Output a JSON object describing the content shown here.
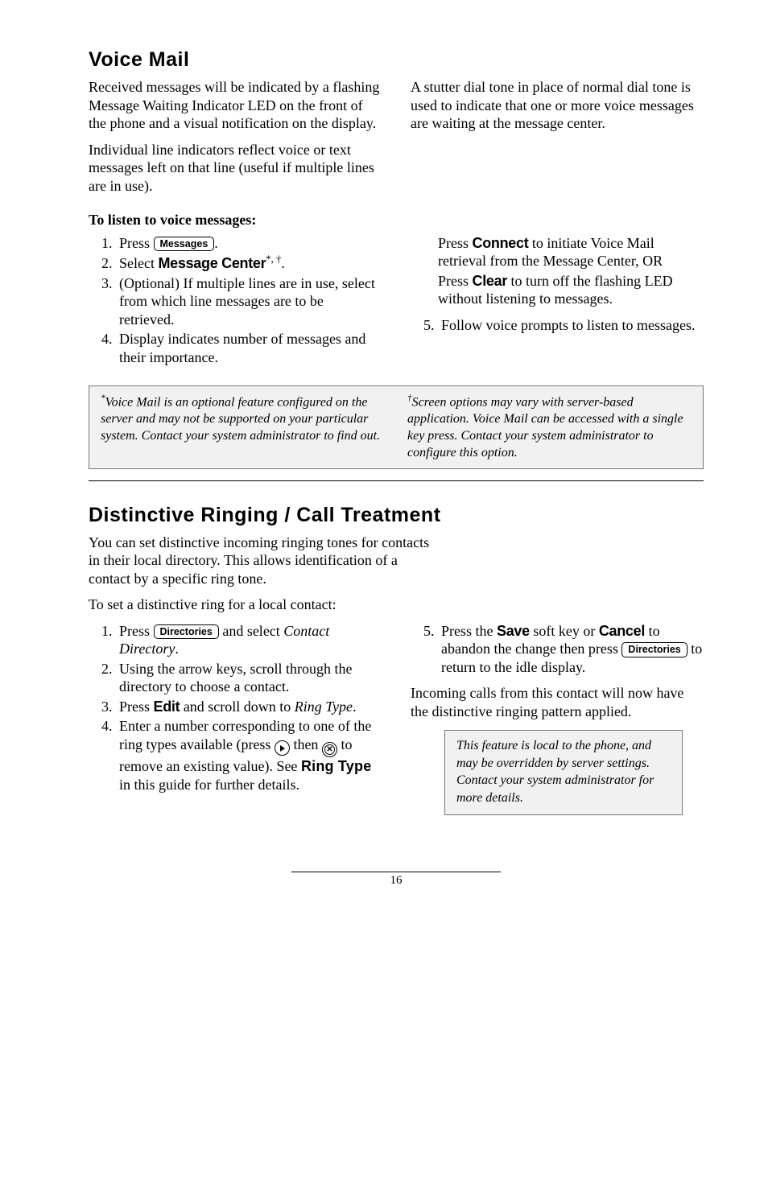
{
  "voicemail": {
    "heading": "Voice Mail",
    "left_p1": "Received messages will be indicated by a flashing Message Waiting Indicator LED on the front of the phone and a visual notification on the display.",
    "left_p2": "Individual line indicators reflect voice or text messages left on that line (useful if multiple lines are in use).",
    "right_p1": "A stutter dial tone in place of normal dial tone is used to indicate that one or more voice messages are waiting at the message center.",
    "sub1": "To listen to voice messages:",
    "step1_a": "Press ",
    "btn_messages": "Messages",
    "step1_b": ".",
    "step2_a": "Select ",
    "step2_label": "Message Center",
    "step2_sup": "*, †",
    "step2_b": ".",
    "step3": "(Optional)  If multiple lines are in use, select from which line messages are to be retrieved.",
    "step4": "Display indicates number of messages and their importance.",
    "right_indent_a": "Press ",
    "connect": "Connect",
    "right_indent_b": " to initiate Voice Mail retrieval from the Message Center, OR",
    "right_indent_c": "Press ",
    "clear": "Clear",
    "right_indent_d": " to turn off the flashing LED without listening to messages.",
    "step5": "Follow voice prompts to listen to messages.",
    "note_left": "Voice Mail is an optional feature configured on the server and may not be supported on your particular system.  Contact your system administrator to find out.",
    "note_right": "Screen options may vary with server-based application.  Voice Mail can be accessed with a single key press.  Contact your system administrator to configure this option."
  },
  "distinctive": {
    "heading": "Distinctive Ringing / Call Treatment",
    "intro": "You can set distinctive incoming ringing tones for contacts in their local directory.  This allows identification of a contact by a specific ring tone.",
    "lead": "To set a distinctive ring for a local contact:",
    "step1_a": "Press ",
    "btn_directories": "Directories",
    "step1_b": " and select ",
    "step1_c": "Contact Directory",
    "step1_d": ".",
    "step2": "Using the arrow keys, scroll through the directory to choose a contact.",
    "step3_a": "Press ",
    "edit": "Edit",
    "step3_b": " and scroll down to ",
    "step3_c": "Ring Type",
    "step3_d": ".",
    "step4_a": "Enter a number corresponding to one of the ring types available (press ",
    "step4_b": " then ",
    "step4_c": " to remove an existing value).  See ",
    "ringtype": "Ring Type",
    "step4_d": " in this guide for further details.",
    "step5_a": "Press the ",
    "save": "Save",
    "step5_b": " soft key or ",
    "cancel": "Cancel",
    "step5_c": " to abandon the change then press ",
    "step5_d": " to return to the idle display.",
    "post": "Incoming calls from this contact will now have the distinctive ringing pattern applied.",
    "note": "This feature is local to the phone, and may be overridden by server settings.  Contact your system administrator for more details."
  },
  "page": "16"
}
